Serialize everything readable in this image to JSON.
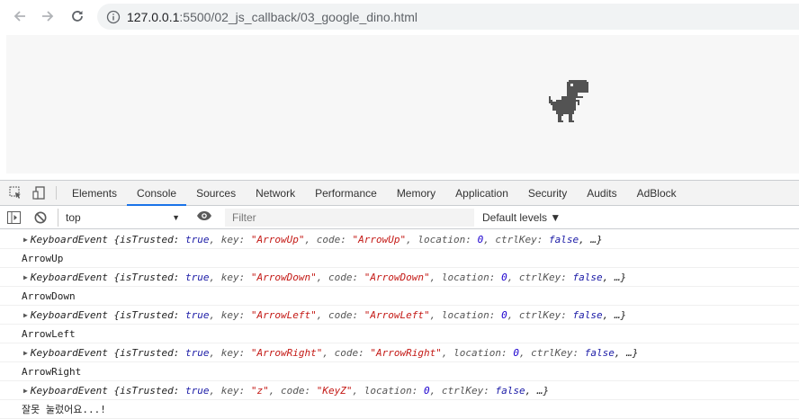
{
  "browser": {
    "url_host": "127.0.0.1",
    "url_rest": ":5500/02_js_callback/03_google_dino.html",
    "icons": [
      "back-arrow-icon",
      "forward-arrow-icon",
      "reload-icon",
      "info-icon"
    ]
  },
  "colors": {
    "accent": "#1a73e8",
    "dino": "#535353",
    "game_bg": "#f7f7f7",
    "string": "#c41a16",
    "keyword": "#1a1aa6"
  },
  "devtools": {
    "tabs": [
      "Elements",
      "Console",
      "Sources",
      "Network",
      "Performance",
      "Memory",
      "Application",
      "Security",
      "Audits",
      "AdBlock"
    ],
    "active_tab": "Console",
    "context": "top",
    "filter_placeholder": "Filter",
    "levels": "Default levels ▼"
  },
  "console": {
    "rows": [
      {
        "prefix": "KeyboardEvent {isTrusted: ",
        "trusted": "true",
        "mid1": ", key: ",
        "key": "\"ArrowUp\"",
        "mid2": ", code: ",
        "code": "\"ArrowUp\"",
        "mid3": ", location: ",
        "loc": "0",
        "mid4": ", ctrlKey: ",
        "ctrl": "false",
        "tail": ", …}",
        "log": "ArrowUp"
      },
      {
        "prefix": "KeyboardEvent {isTrusted: ",
        "trusted": "true",
        "mid1": ", key: ",
        "key": "\"ArrowDown\"",
        "mid2": ", code: ",
        "code": "\"ArrowDown\"",
        "mid3": ", location: ",
        "loc": "0",
        "mid4": ", ctrlKey: ",
        "ctrl": "false",
        "tail": ", …}",
        "log": "ArrowDown"
      },
      {
        "prefix": "KeyboardEvent {isTrusted: ",
        "trusted": "true",
        "mid1": ", key: ",
        "key": "\"ArrowLeft\"",
        "mid2": ", code: ",
        "code": "\"ArrowLeft\"",
        "mid3": ", location: ",
        "loc": "0",
        "mid4": ", ctrlKey: ",
        "ctrl": "false",
        "tail": ", …}",
        "log": "ArrowLeft"
      },
      {
        "prefix": "KeyboardEvent {isTrusted: ",
        "trusted": "true",
        "mid1": ", key: ",
        "key": "\"ArrowRight\"",
        "mid2": ", code: ",
        "code": "\"ArrowRight\"",
        "mid3": ", location: ",
        "loc": "0",
        "mid4": ", ctrlKey: ",
        "ctrl": "false",
        "tail": ", …}",
        "log": "ArrowRight"
      },
      {
        "prefix": "KeyboardEvent {isTrusted: ",
        "trusted": "true",
        "mid1": ", key: ",
        "key": "\"z\"",
        "mid2": ", code: ",
        "code": "\"KeyZ\"",
        "mid3": ", location: ",
        "loc": "0",
        "mid4": ", ctrlKey: ",
        "ctrl": "false",
        "tail": ", …}",
        "log": "잘못 눌렀어요...!"
      }
    ]
  }
}
